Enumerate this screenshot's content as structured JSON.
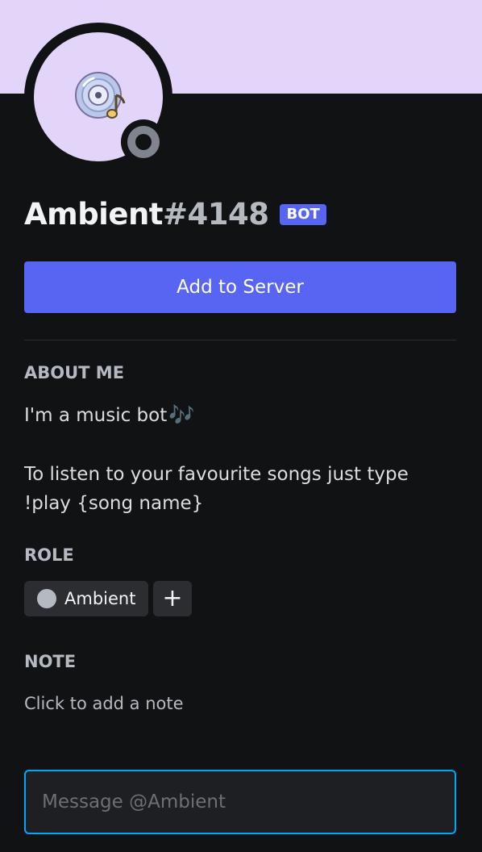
{
  "profile": {
    "username": "Ambient",
    "discriminator": "#4148",
    "tag": "BOT",
    "avatar_icon": "music-disc-icon",
    "status": "offline"
  },
  "actions": {
    "add_to_server": "Add to Server"
  },
  "about": {
    "title": "ABOUT ME",
    "line1": "I'm a music bot",
    "line1_emoji": "🎶",
    "paragraph": "To listen to your favourite songs just type !play {song name}"
  },
  "role": {
    "title": "ROLE",
    "items": [
      {
        "name": "Ambient",
        "color": "#b5bac1"
      }
    ],
    "add_label": "+"
  },
  "note": {
    "title": "NOTE",
    "placeholder": "Click to add a note"
  },
  "message": {
    "placeholder": "Message @Ambient"
  },
  "colors": {
    "banner": "#e3d4f9",
    "accent": "#5865f2",
    "background": "#111214",
    "input_focus": "#00a8fc"
  }
}
